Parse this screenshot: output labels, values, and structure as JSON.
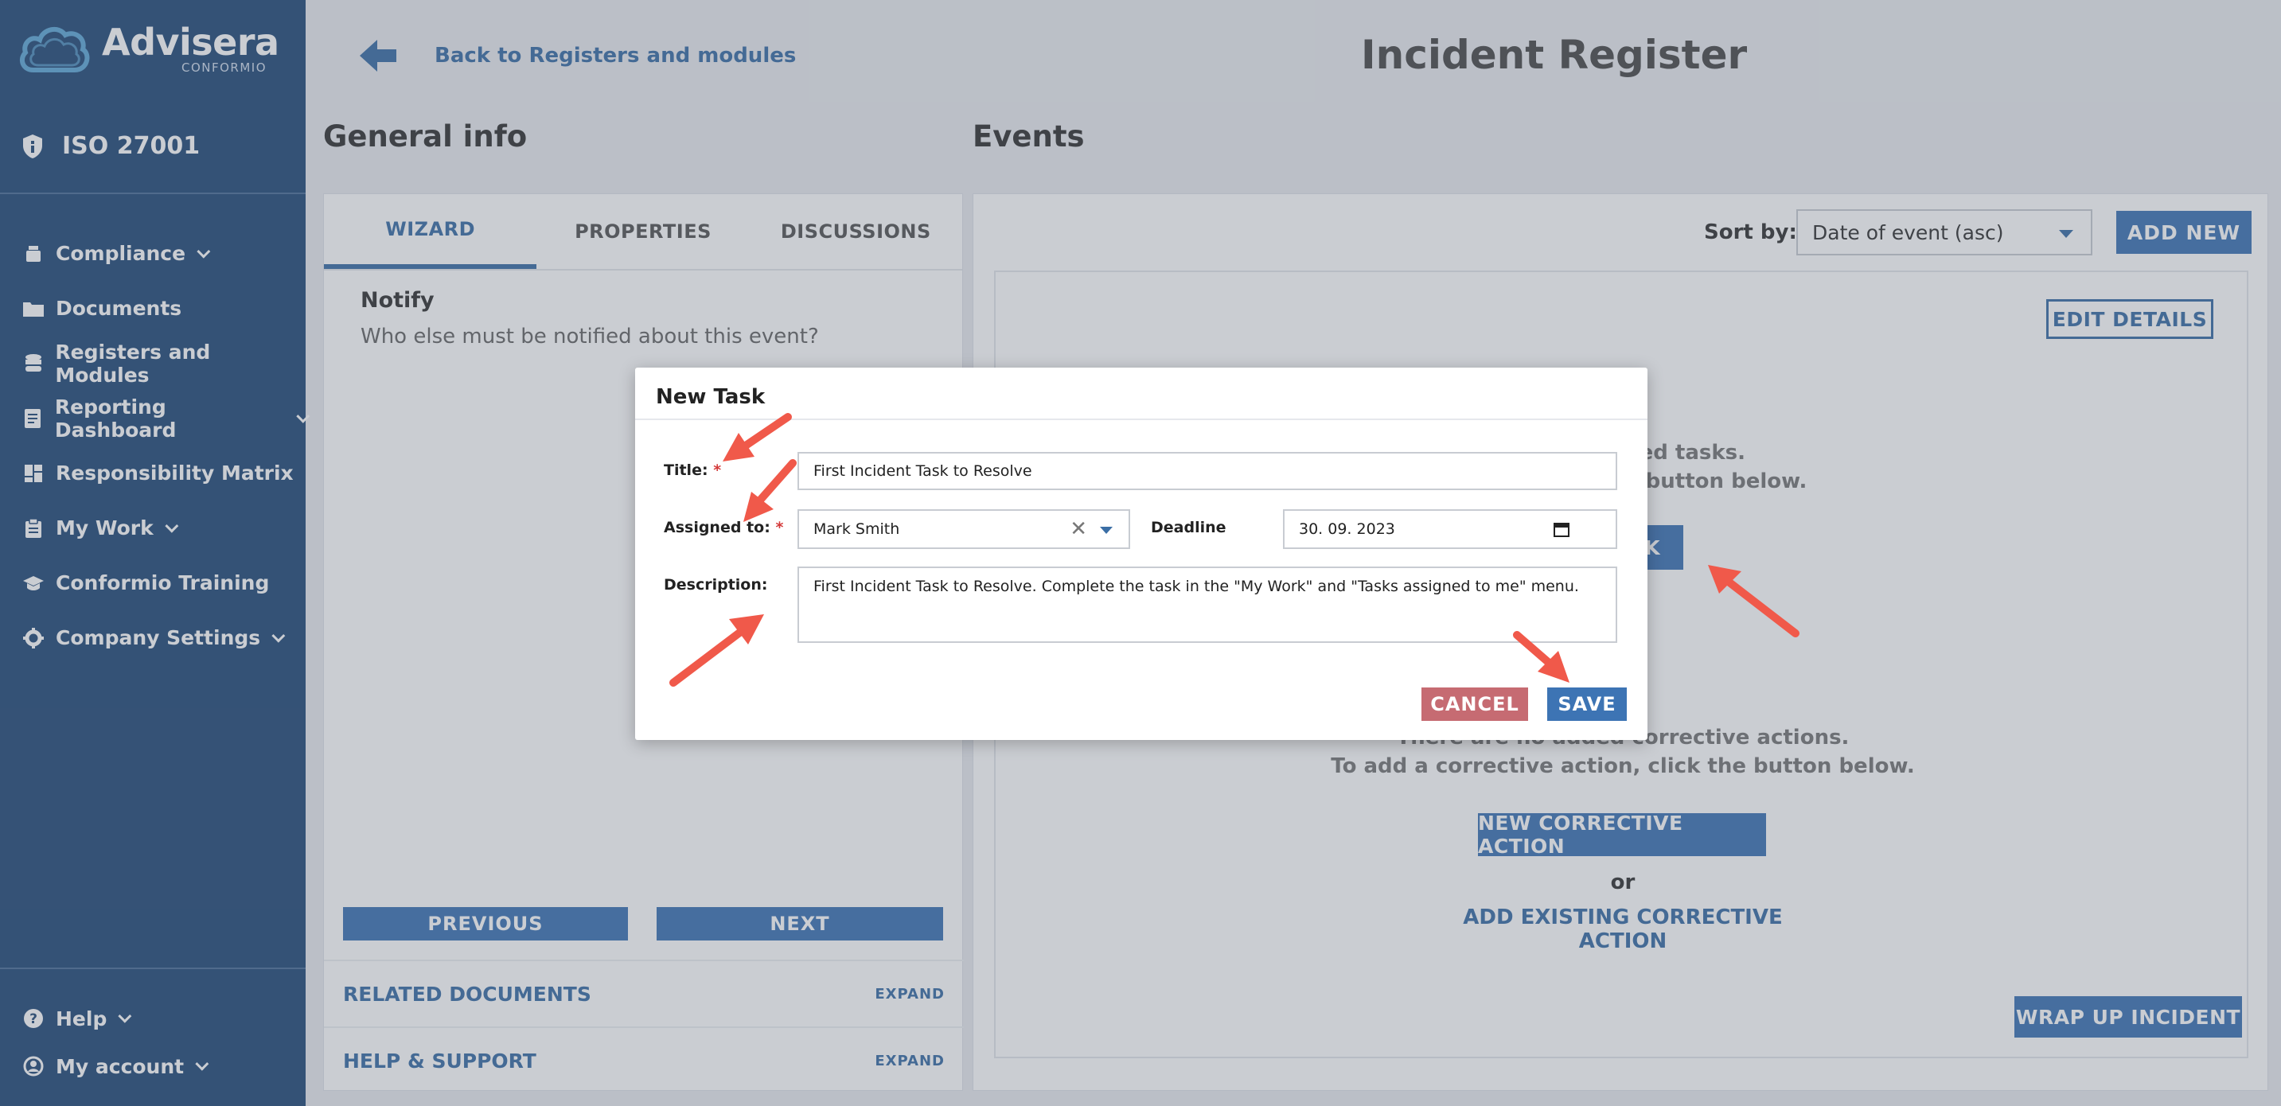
{
  "brand": {
    "name": "Advisera",
    "sub": "CONFORMIO"
  },
  "sidebar": {
    "standard": "ISO 27001",
    "items": [
      {
        "label": "Compliance",
        "icon": "compliance-icon",
        "has_chevron": true
      },
      {
        "label": "Documents",
        "icon": "folder-icon",
        "has_chevron": false
      },
      {
        "label": "Registers and Modules",
        "icon": "database-icon",
        "has_chevron": false
      },
      {
        "label": "Reporting Dashboard",
        "icon": "report-icon",
        "has_chevron": true
      },
      {
        "label": "Responsibility Matrix",
        "icon": "grid-icon",
        "has_chevron": false
      },
      {
        "label": "My Work",
        "icon": "clipboard-icon",
        "has_chevron": true
      },
      {
        "label": "Conformio Training",
        "icon": "graduation-cap-icon",
        "has_chevron": false
      },
      {
        "label": "Company Settings",
        "icon": "gear-icon",
        "has_chevron": true
      }
    ],
    "bottom": [
      {
        "label": "Help",
        "icon": "help-icon"
      },
      {
        "label": "My account",
        "icon": "user-icon"
      }
    ],
    "bg_color": "#234a78"
  },
  "header": {
    "back_label": "Back to Registers and modules",
    "title": "Incident Register"
  },
  "general": {
    "title": "General info",
    "tabs": [
      "WIZARD",
      "PROPERTIES",
      "DISCUSSIONS"
    ],
    "active_tab": "WIZARD",
    "notify_title": "Notify",
    "notify_question": "Who else must be notified about this event?",
    "prev_label": "PREVIOUS",
    "next_label": "NEXT",
    "related_docs": "RELATED DOCUMENTS",
    "help_support": "HELP & SUPPORT",
    "expand": "EXPAND"
  },
  "events": {
    "title": "Events",
    "sort_label": "Sort by:",
    "sort_value": "Date of event (asc)",
    "add_new": "ADD NEW",
    "edit_details": "EDIT DETAILS",
    "tasks_line1": "ded tasks.",
    "tasks_line2": "e button below.",
    "task_btn_partial": "SK",
    "ca_line1": "There are no added corrective actions.",
    "ca_line2": "To add a corrective action, click the button below.",
    "new_ca": "NEW CORRECTIVE ACTION",
    "or": "or",
    "add_existing_ca": "ADD EXISTING CORRECTIVE ACTION",
    "wrap_up": "WRAP UP INCIDENT"
  },
  "modal": {
    "title": "New Task",
    "title_label": "Title:",
    "title_value": "First Incident Task to Resolve",
    "assigned_label": "Assigned to:",
    "assigned_value": "Mark Smith",
    "deadline_label": "Deadline",
    "deadline_value": "30. 09. 2023",
    "description_label": "Description:",
    "description_value": "First Incident Task to Resolve. Complete the task in the \"My Work\" and \"Tasks assigned to me\" menu.",
    "required_mark": "*",
    "cancel": "CANCEL",
    "save": "SAVE",
    "cancel_color": "#c66b72",
    "save_color": "#3d74b4"
  },
  "annotation_color": "#f0594a"
}
